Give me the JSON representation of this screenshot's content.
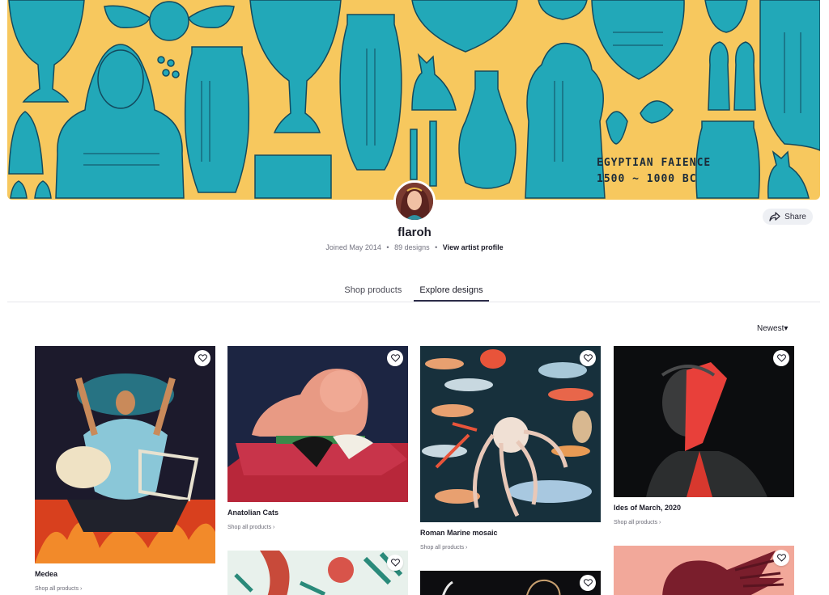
{
  "banner": {
    "caption_line1": "EGYPTIAN FAIENCE",
    "caption_line2": "1500 ~ 1000 BC"
  },
  "artist": {
    "name": "flaroh",
    "joined": "Joined May 2014",
    "designs": "89 designs",
    "profile_link": "View artist profile",
    "separator": "•"
  },
  "share": {
    "label": "Share"
  },
  "tabs": [
    {
      "label": "Shop products",
      "active": false
    },
    {
      "label": "Explore designs",
      "active": true
    }
  ],
  "sort": {
    "label": "Newest",
    "chevron": "▾"
  },
  "designs": [
    {
      "title": "Medea",
      "link": "Shop all products ›"
    },
    {
      "title": "Anatolian Cats",
      "link": "Shop all products ›"
    },
    {
      "title": "Roman Marine mosaic",
      "link": "Shop all products ›"
    },
    {
      "title": "Ides of March, 2020",
      "link": "Shop all products ›"
    }
  ],
  "colors": {
    "banner_bg": "#f7c85e",
    "faience_teal": "#22a8b8",
    "text_dark": "#1c1c28",
    "muted": "#737380"
  }
}
